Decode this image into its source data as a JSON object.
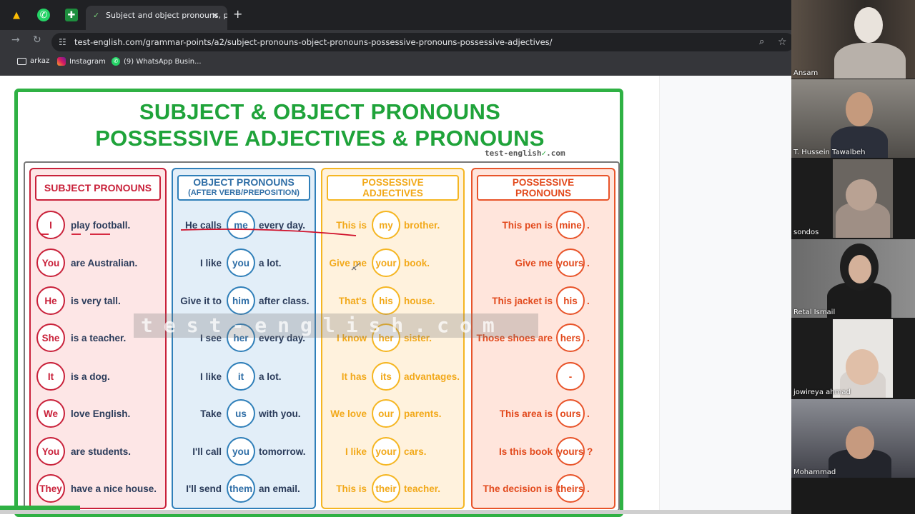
{
  "browser": {
    "tab_title": "Subject and object pronouns, p",
    "url": "test-english.com/grammar-points/a2/subject-pronouns-object-pronouns-possessive-pronouns-possessive-adjectives/",
    "bookmarks": [
      {
        "label": "arkaz",
        "icon": "folder-icon"
      },
      {
        "label": "Instagram",
        "icon": "instagram-icon"
      },
      {
        "label": "(9) WhatsApp Busin...",
        "icon": "whatsapp-icon"
      }
    ]
  },
  "poster": {
    "title_line1": "SUBJECT & OBJECT PRONOUNS",
    "title_line2": "POSSESSIVE ADJECTIVES & PRONOUNS",
    "brand_a": "test-english",
    "brand_b": ".com",
    "watermark": "test-english.com",
    "columns": {
      "subject": {
        "header": "SUBJECT PRONOUNS",
        "rows": [
          {
            "word": "I",
            "rest": "play football."
          },
          {
            "word": "You",
            "rest": "are Australian."
          },
          {
            "word": "He",
            "rest": "is very tall."
          },
          {
            "word": "She",
            "rest": "is a teacher."
          },
          {
            "word": "It",
            "rest": "is a dog."
          },
          {
            "word": "We",
            "rest": "love English."
          },
          {
            "word": "You",
            "rest": "are students."
          },
          {
            "word": "They",
            "rest": "have a nice house."
          }
        ]
      },
      "object": {
        "header": "OBJECT PRONOUNS",
        "subheader": "(AFTER VERB/PREPOSITION)",
        "rows": [
          {
            "pre": "He calls",
            "word": "me",
            "post": "every day."
          },
          {
            "pre": "I like",
            "word": "you",
            "post": "a lot."
          },
          {
            "pre": "Give it to",
            "word": "him",
            "post": "after class."
          },
          {
            "pre": "I see",
            "word": "her",
            "post": "every day."
          },
          {
            "pre": "I like",
            "word": "it",
            "post": "a lot."
          },
          {
            "pre": "Take",
            "word": "us",
            "post": "with you."
          },
          {
            "pre": "I'll call",
            "word": "you",
            "post": "tomorrow."
          },
          {
            "pre": "I'll send",
            "word": "them",
            "post": "an email."
          }
        ]
      },
      "poss_adj": {
        "header_line1": "POSSESSIVE",
        "header_line2": "ADJECTIVES",
        "rows": [
          {
            "pre": "This is",
            "word": "my",
            "post": "brother."
          },
          {
            "pre": "Give me",
            "word": "your",
            "post": "book."
          },
          {
            "pre": "That's",
            "word": "his",
            "post": "house."
          },
          {
            "pre": "I know",
            "word": "her",
            "post": "sister."
          },
          {
            "pre": "It has",
            "word": "its",
            "post": "advantages."
          },
          {
            "pre": "We love",
            "word": "our",
            "post": "parents."
          },
          {
            "pre": "I like",
            "word": "your",
            "post": "cars."
          },
          {
            "pre": "This is",
            "word": "their",
            "post": "teacher."
          }
        ]
      },
      "poss_pron": {
        "header_line1": "POSSESSIVE",
        "header_line2": "PRONOUNS",
        "rows": [
          {
            "pre": "This pen is",
            "word": "mine",
            "post": "."
          },
          {
            "pre": "Give me",
            "word": "yours",
            "post": "."
          },
          {
            "pre": "This jacket is",
            "word": "his",
            "post": "."
          },
          {
            "pre": "Those shoes are",
            "word": "hers",
            "post": "."
          },
          {
            "pre": "",
            "word": "-",
            "post": ""
          },
          {
            "pre": "This area is",
            "word": "ours",
            "post": "."
          },
          {
            "pre": "Is this book",
            "word": "yours",
            "post": "?"
          },
          {
            "pre": "The decision is",
            "word": "theirs",
            "post": "."
          }
        ]
      }
    }
  },
  "participants": [
    {
      "name": "Ansam"
    },
    {
      "name": "T. Hussein Tawalbeh"
    },
    {
      "name": "sondos"
    },
    {
      "name": "Retal Ismail"
    },
    {
      "name": "jowireya ahmad"
    },
    {
      "name": "Mohammad"
    }
  ],
  "colors": {
    "title_green": "#1fa33a",
    "subject_red": "#c9213a",
    "object_blue": "#2f7fb9",
    "adj_yellow": "#f5b622",
    "pron_orange": "#e8542a"
  }
}
